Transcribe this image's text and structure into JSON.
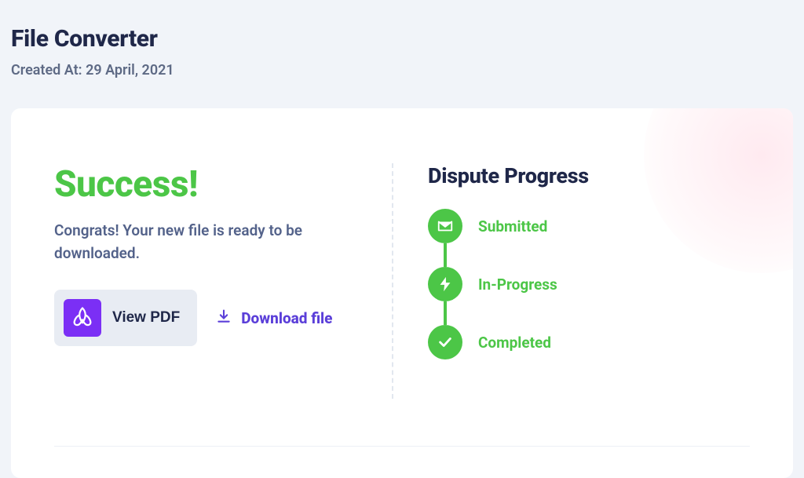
{
  "header": {
    "title": "File Converter",
    "subtitle": "Created At: 29 April, 2021"
  },
  "success": {
    "title": "Success!",
    "desc": "Congrats! Your new file is ready to be downloaded.",
    "view_pdf_label": "View PDF",
    "download_label": "Download file"
  },
  "progress": {
    "title": "Dispute Progress",
    "steps": [
      {
        "label": "Submitted"
      },
      {
        "label": "In-Progress"
      },
      {
        "label": "Completed"
      }
    ]
  },
  "colors": {
    "success_green": "#4cc647",
    "purple": "#7b2ff5",
    "link_purple": "#5b3fd9",
    "dark_navy": "#1f2749"
  }
}
